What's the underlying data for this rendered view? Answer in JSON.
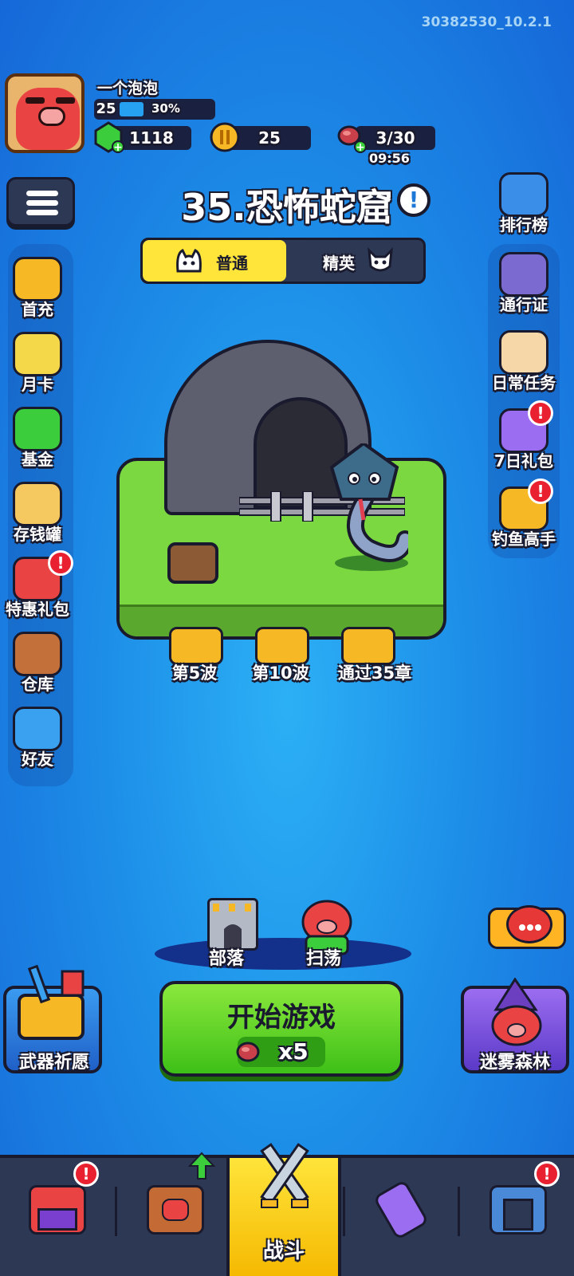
{
  "version": "30382530_10.2.1",
  "player": {
    "name": "一个泡泡",
    "level": "25",
    "progress": "30%",
    "progress_value": 0.3
  },
  "resources": {
    "gems": "1118",
    "coins": "25",
    "energy": "3/30",
    "energy_timer": "09:56"
  },
  "stage": {
    "title": "35.恐怖蛇窟",
    "info_icon": "!"
  },
  "modes": {
    "normal": "普通",
    "elite": "精英",
    "selected": "普通"
  },
  "left_menu": [
    {
      "label": "首充",
      "icon": "gem-treasure-icon"
    },
    {
      "label": "月卡",
      "icon": "card-icon"
    },
    {
      "label": "基金",
      "icon": "gem-arrow-icon"
    },
    {
      "label": "存钱罐",
      "icon": "lucky-cat-icon"
    },
    {
      "label": "特惠礼包",
      "icon": "gift-icon",
      "badge": "!"
    },
    {
      "label": "仓库",
      "icon": "backpack-icon"
    },
    {
      "label": "好友",
      "icon": "friends-icon"
    }
  ],
  "right_menu": [
    {
      "label": "排行榜",
      "icon": "trophy-icon"
    },
    {
      "label": "通行证",
      "icon": "pass-badge-icon"
    },
    {
      "label": "日常任务",
      "icon": "scroll-icon"
    },
    {
      "label": "7日礼包",
      "icon": "seven-day-gift-icon",
      "badge": "!"
    },
    {
      "label": "钓鱼高手",
      "icon": "fishing-icon",
      "badge": "!"
    }
  ],
  "rewards": [
    {
      "label": "第5波"
    },
    {
      "label": "第10波"
    },
    {
      "label": "通过35章"
    }
  ],
  "actions": {
    "tribe": "部落",
    "raid": "扫荡",
    "start": "开始游戏",
    "start_cost": "x5",
    "weapon_wish": "武器祈愿",
    "misty_forest": "迷雾森林"
  },
  "tabs": [
    {
      "name": "shop",
      "label": "",
      "badge": "!"
    },
    {
      "name": "heroes",
      "label": ""
    },
    {
      "name": "battle",
      "label": "战斗"
    },
    {
      "name": "scroll",
      "label": ""
    },
    {
      "name": "building",
      "label": "",
      "badge": "!"
    }
  ],
  "colors": {
    "accent": "#ffe43a",
    "start": "#5ad024",
    "background": "#1d8ee8",
    "badge": "#e82030"
  }
}
